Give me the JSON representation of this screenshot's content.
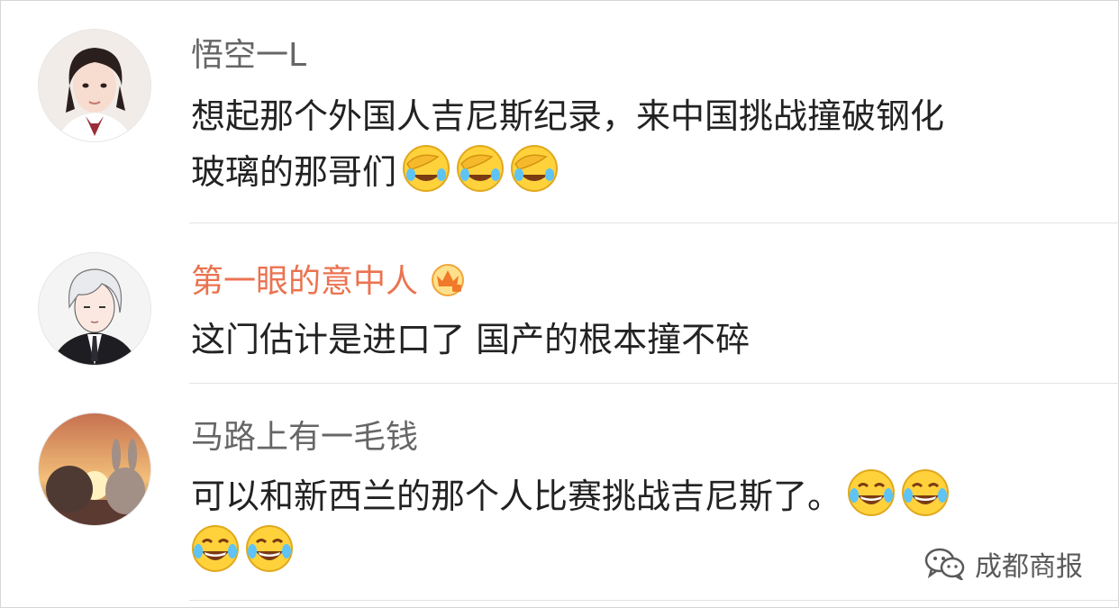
{
  "comments": [
    {
      "username": "悟空一L",
      "avatar": "avatar-girl",
      "lines": [
        "想起那个外国人吉尼斯纪录，来中国挑战撞破钢化",
        "玻璃的那哥们"
      ],
      "emojis": [
        "facepalm-laugh-icon",
        "facepalm-laugh-icon",
        "facepalm-laugh-icon"
      ]
    },
    {
      "username": "第一眼的意中人",
      "vip_badge": "crown-icon",
      "avatar": "avatar-anime-man",
      "lines": [
        "这门估计是进口了 国产的根本撞不碎"
      ]
    },
    {
      "username": "马路上有一毛钱",
      "avatar": "avatar-bunny-sunset",
      "lines": [
        "可以和新西兰的那个人比赛挑战吉尼斯了。"
      ],
      "emojis_line1": [
        "tears-of-joy-icon",
        "tears-of-joy-icon"
      ],
      "emojis_line2": [
        "tears-of-joy-icon",
        "tears-of-joy-icon"
      ]
    }
  ],
  "watermark": {
    "label": "成都商报",
    "icon": "wechat-icon"
  },
  "colors": {
    "vip_name": "#eb7350",
    "name": "#666666",
    "text": "#222222",
    "divider": "#e3e3e3"
  }
}
